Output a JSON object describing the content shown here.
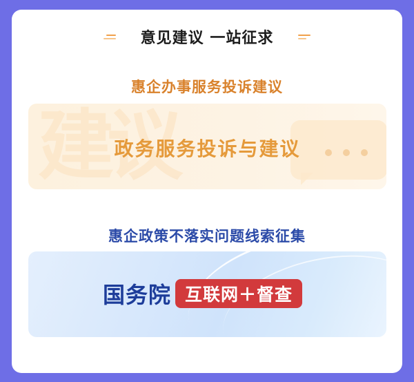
{
  "header": {
    "title": "意见建议 一站征求"
  },
  "section1": {
    "label": "惠企办事服务投诉建议",
    "banner_title": "政务服务投诉与建议",
    "banner_watermark": "建议"
  },
  "section2": {
    "label": "惠企政策不落实问题线索征集",
    "banner_org": "国务院",
    "banner_pill": "互联网＋督查"
  },
  "colors": {
    "background": "#6e6ee6",
    "orange_accent": "#e59a3b",
    "blue_accent": "#2b4aa8",
    "red_pill": "#d23a3c"
  }
}
